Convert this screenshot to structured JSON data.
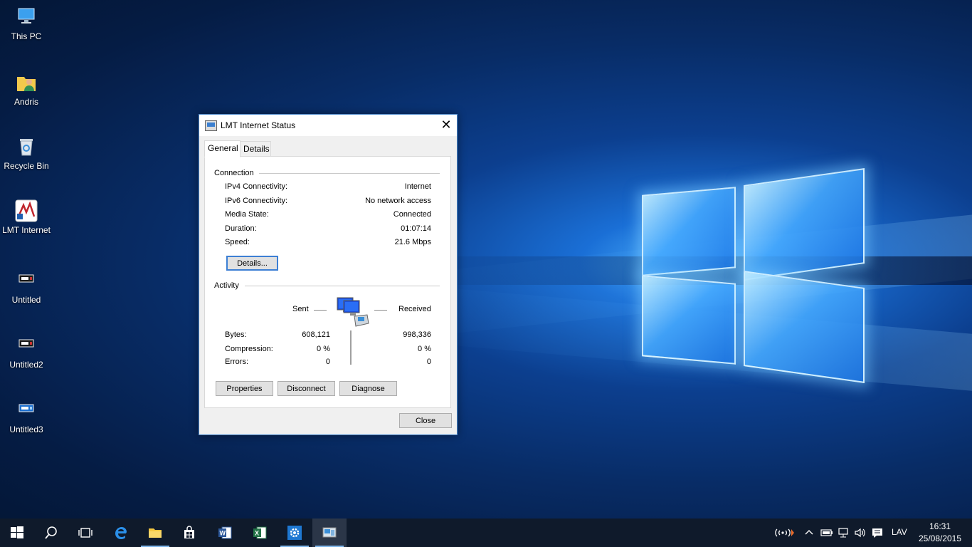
{
  "desktop": {
    "icons": [
      {
        "label": "This PC"
      },
      {
        "label": "Andris"
      },
      {
        "label": "Recycle Bin"
      },
      {
        "label": "LMT Internet"
      },
      {
        "label": "Untitled"
      },
      {
        "label": "Untitled2"
      },
      {
        "label": "Untitled3"
      }
    ]
  },
  "dialog": {
    "title": "LMT Internet Status",
    "tabs": [
      {
        "label": "General"
      },
      {
        "label": "Details"
      }
    ],
    "connection": {
      "header": "Connection",
      "rows": [
        {
          "label": "IPv4 Connectivity:",
          "value": "Internet"
        },
        {
          "label": "IPv6 Connectivity:",
          "value": "No network access"
        },
        {
          "label": "Media State:",
          "value": "Connected"
        },
        {
          "label": "Duration:",
          "value": "01:07:14"
        },
        {
          "label": "Speed:",
          "value": "21.6 Mbps"
        }
      ],
      "details_button": "Details..."
    },
    "activity": {
      "header": "Activity",
      "sent_label": "Sent",
      "received_label": "Received",
      "rows": [
        {
          "label": "Bytes:",
          "sent": "608,121",
          "received": "998,336"
        },
        {
          "label": "Compression:",
          "sent": "0 %",
          "received": "0 %"
        },
        {
          "label": "Errors:",
          "sent": "0",
          "received": "0"
        }
      ]
    },
    "buttons": {
      "properties": "Properties",
      "disconnect": "Disconnect",
      "diagnose": "Diagnose"
    },
    "close_button": "Close"
  },
  "taskbar": {
    "language": "LAV",
    "time": "16:31",
    "date": "25/08/2015"
  },
  "colors": {
    "accent": "#3c7fd4",
    "taskbar": "#0f1a2b"
  }
}
